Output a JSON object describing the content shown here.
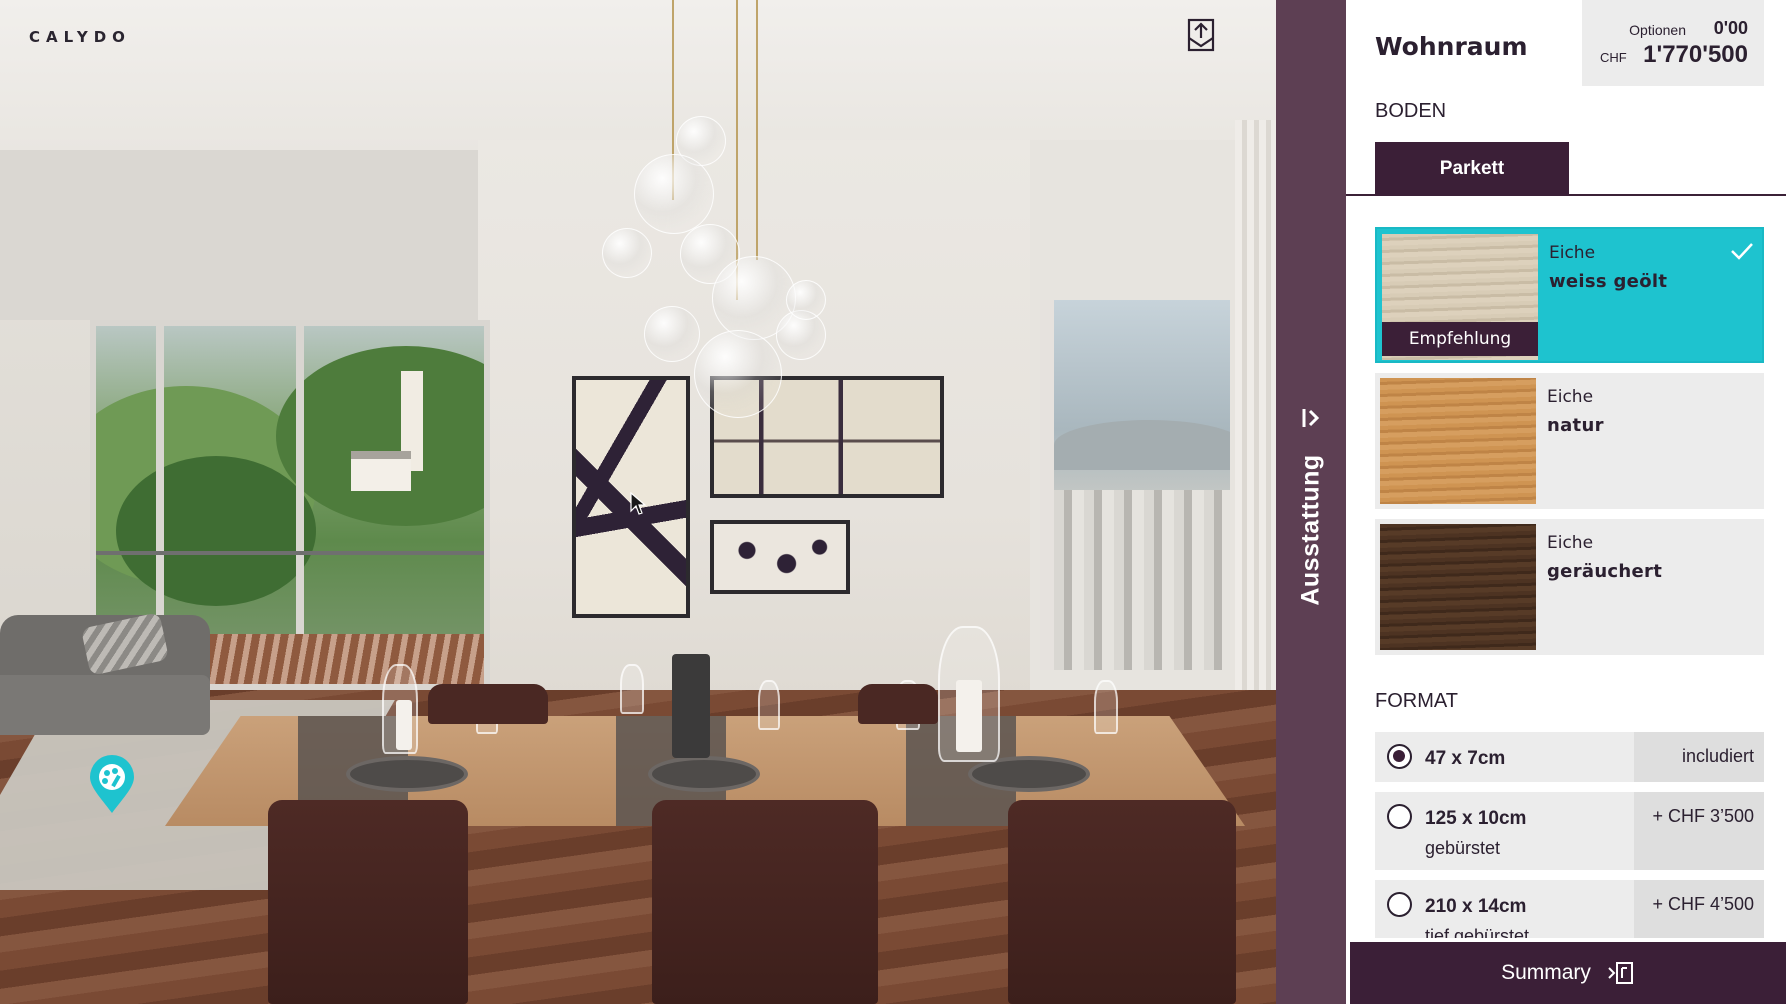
{
  "brand": {
    "logo": "CALYDO"
  },
  "scene": {
    "alt": "Wohnraum"
  },
  "sidebar_tab": {
    "label": "Ausstattung",
    "icon": "collapse-arrow-icon"
  },
  "panel": {
    "room_title": "Wohnraum",
    "price": {
      "options_label": "Optionen",
      "options_value": "0'00",
      "currency": "CHF",
      "total": "1'770'500"
    },
    "floor_section": {
      "title": "BODEN",
      "tabs": [
        {
          "label": "Parkett",
          "active": true
        }
      ],
      "materials": [
        {
          "line1": "Eiche",
          "line2": "weiss geölt",
          "badge": "Empfehlung",
          "selected": true,
          "color": "#d3c6b0"
        },
        {
          "line1": "Eiche",
          "line2": "natur",
          "badge": "",
          "selected": false,
          "color": "#c98e4f"
        },
        {
          "line1": "Eiche",
          "line2": "geräuchert",
          "badge": "",
          "selected": false,
          "color": "#4a3020"
        }
      ]
    },
    "format_section": {
      "title": "FORMAT",
      "options": [
        {
          "size": "47 x 7cm",
          "sub": "",
          "price": "includiert",
          "checked": true
        },
        {
          "size": "125 x 10cm",
          "sub": "gebürstet",
          "price": "+ CHF 3’500",
          "checked": false
        },
        {
          "size": "210 x 14cm",
          "sub": "tief gebürstet",
          "price": "+ CHF 4’500",
          "checked": false
        }
      ]
    },
    "summary_button": {
      "label": "Summary"
    }
  },
  "colors": {
    "accent": "#1ec3cf",
    "brand_dark": "#3b1f37",
    "tab_bg": "#5d3f53"
  }
}
